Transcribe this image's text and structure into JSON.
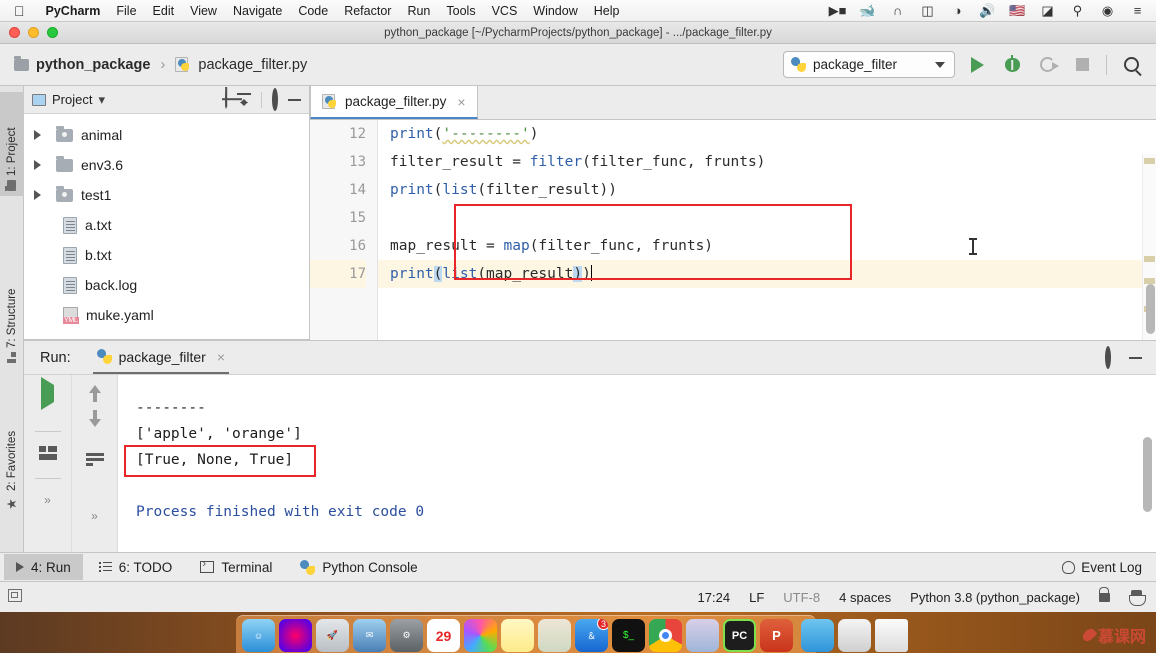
{
  "mac_menu": {
    "apple_icon": "apple-icon",
    "items": [
      "PyCharm",
      "File",
      "Edit",
      "View",
      "Navigate",
      "Code",
      "Refactor",
      "Run",
      "Tools",
      "VCS",
      "Window",
      "Help"
    ],
    "tray_icons": [
      "screen-record-icon",
      "docker-icon",
      "tunnel-icon",
      "battery-icon",
      "wifi-icon",
      "volume-icon",
      "us-flag-icon",
      "clock-icon",
      "spotlight-search-icon",
      "siri-icon",
      "control-center-icon"
    ]
  },
  "window": {
    "title": "python_package [~/PycharmProjects/python_package] - .../package_filter.py",
    "traffic_lights": [
      "close-button",
      "minimize-button",
      "maximize-button"
    ]
  },
  "breadcrumb": {
    "project": "python_package",
    "separator": "›",
    "file": "package_filter.py"
  },
  "toolbar": {
    "run_config": "package_filter",
    "run_button": "run-button",
    "debug_button": "debug-button",
    "coverage_button": "coverage-button",
    "stop_button": "stop-button",
    "search_button": "search-everywhere-button"
  },
  "left_strip": {
    "tabs": [
      {
        "label": "1: Project",
        "icon": "project-folder-icon",
        "active": true
      },
      {
        "label": "7: Structure",
        "icon": "structure-icon",
        "active": false
      },
      {
        "label": "2: Favorites",
        "icon": "star-icon",
        "active": false
      }
    ]
  },
  "project_panel": {
    "title": "Project",
    "title_caret": "▾",
    "actions": [
      "locate-icon",
      "collapse-all-icon",
      "settings-gear-icon",
      "hide-icon"
    ],
    "tree": [
      {
        "name": "animal",
        "type": "folder-source",
        "expandable": true
      },
      {
        "name": "env3.6",
        "type": "folder",
        "expandable": true
      },
      {
        "name": "test1",
        "type": "folder-source",
        "expandable": true
      },
      {
        "name": "a.txt",
        "type": "text-file",
        "expandable": false
      },
      {
        "name": "b.txt",
        "type": "text-file",
        "expandable": false
      },
      {
        "name": "back.log",
        "type": "text-file",
        "expandable": false
      },
      {
        "name": "muke.yaml",
        "type": "yaml-file",
        "badge": "YML",
        "expandable": false
      }
    ]
  },
  "editor": {
    "tab": {
      "label": "package_filter.py",
      "close": "×"
    },
    "lines": [
      {
        "num": "12",
        "text": "print('--------')",
        "current": false
      },
      {
        "num": "13",
        "text": "filter_result = filter(filter_func, frunts)",
        "current": false
      },
      {
        "num": "14",
        "text": "print(list(filter_result))",
        "current": false
      },
      {
        "num": "15",
        "text": "",
        "current": false
      },
      {
        "num": "16",
        "text": "map_result = map(filter_func, frunts)",
        "current": false
      },
      {
        "num": "17",
        "text": "print(list(map_result))",
        "current": true
      }
    ],
    "annotation_box": {
      "color": "#e8262a",
      "covers_lines": [
        "16",
        "17"
      ]
    },
    "current_line": "17"
  },
  "run_window": {
    "label": "Run:",
    "tab": "package_filter",
    "tab_close": "×",
    "header_actions": [
      "settings-gear-icon",
      "hide-icon"
    ],
    "tool_icons": [
      "rerun-icon",
      "stop-icon",
      "print-icon",
      "scroll-up-icon",
      "scroll-down-icon",
      "soft-wrap-icon"
    ],
    "console_lines": [
      {
        "text": "--------",
        "style": "normal"
      },
      {
        "text": "['apple', 'orange']",
        "style": "normal"
      },
      {
        "text": "[True, None, True]",
        "style": "normal",
        "boxed": true
      },
      {
        "text": "",
        "style": "normal"
      },
      {
        "text": "Process finished with exit code 0",
        "style": "blue"
      }
    ],
    "annotation_box_color": "#e8262a"
  },
  "bottom_bar": {
    "items": [
      {
        "label": "4: Run",
        "key": "4",
        "icon": "run-triangle-icon",
        "active": true
      },
      {
        "label": "6: TODO",
        "key": "6",
        "icon": "todo-list-icon",
        "active": false
      },
      {
        "label": "Terminal",
        "icon": "terminal-icon",
        "active": false
      },
      {
        "label": "Python Console",
        "icon": "python-icon",
        "active": false
      }
    ],
    "event_log": {
      "label": "Event Log",
      "icon": "bell-icon"
    }
  },
  "status_bar": {
    "left_icon": "toggle-toolwindow-icon",
    "time": "17:24",
    "line_separator": "LF",
    "encoding": "UTF-8",
    "indent": "4 spaces",
    "interpreter": "Python 3.8 (python_package)",
    "lock_icon": "unlocked-icon",
    "inspector_icon": "hector-inspector-icon"
  },
  "dock": {
    "apps": [
      {
        "name": "finder-icon",
        "color": "#3aa8e8",
        "glyph": ""
      },
      {
        "name": "siri-icon",
        "color": "#2b2b3c",
        "glyph": ""
      },
      {
        "name": "launchpad-icon",
        "color": "#c8ccd0",
        "glyph": ""
      },
      {
        "name": "mail-icon",
        "color": "#4d7fb5",
        "glyph": ""
      },
      {
        "name": "system-preferences-icon",
        "color": "#6e7377",
        "glyph": ""
      },
      {
        "name": "calendar-icon",
        "color": "#ffffff",
        "glyph": "29"
      },
      {
        "name": "photos-icon",
        "color": "#f5f5f5",
        "glyph": ""
      },
      {
        "name": "notes-icon",
        "color": "#fdf3b8",
        "glyph": ""
      },
      {
        "name": "maps-icon",
        "color": "#e8e3d8",
        "glyph": ""
      },
      {
        "name": "app-store-icon",
        "color": "#2b8ced",
        "glyph": "",
        "badge": "3"
      },
      {
        "name": "terminal-icon",
        "color": "#141414",
        "glyph": ""
      },
      {
        "name": "chrome-icon",
        "color": "#e8453c",
        "glyph": ""
      },
      {
        "name": "video-editor-icon",
        "color": "#c9c3d8",
        "glyph": ""
      },
      {
        "name": "pycharm-icon",
        "color": "#1d1d1d",
        "glyph": "PC"
      },
      {
        "name": "powerpoint-icon",
        "color": "#d24726",
        "glyph": "P"
      },
      {
        "name": "downloads-folder-icon",
        "color": "#4aa8e0",
        "glyph": ""
      },
      {
        "name": "printer-icon",
        "color": "#e6e6e6",
        "glyph": ""
      },
      {
        "name": "trash-icon",
        "color": "#f0f0f0",
        "glyph": ""
      }
    ]
  },
  "watermark": {
    "text": "慕课网"
  }
}
